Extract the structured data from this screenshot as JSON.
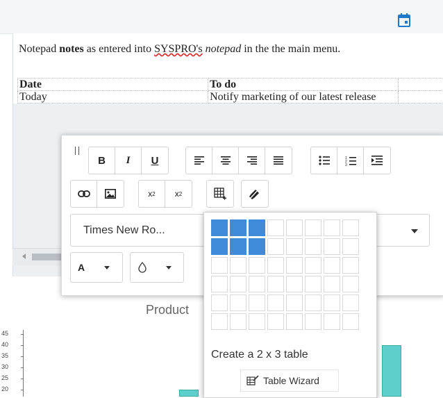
{
  "icons": {
    "calendar": "calendar-icon",
    "grip": "drag-handle-icon",
    "link": "link-icon",
    "image": "image-icon",
    "table_insert": "table-insert-icon",
    "clear_format": "clear-format-icon",
    "text_color": "text-color-icon",
    "fill_color": "fill-color-icon",
    "table_wizard": "table-wizard-icon",
    "align_left": "align-left-icon",
    "align_center": "align-center-icon",
    "align_right": "align-right-icon",
    "align_justify": "align-justify-icon",
    "bullet_list": "bullet-list-icon",
    "numbered_list": "numbered-list-icon",
    "indent": "indent-icon"
  },
  "colors": {
    "accent": "#1f78c8",
    "selected_cell": "#3f8ad9",
    "bar": "#5fcfcb"
  },
  "document": {
    "paragraph": {
      "t1": "Notepad ",
      "t2": "notes",
      "t3": " as entered into ",
      "t4": "SYSPRO's",
      "t5": " ",
      "t6": "notepad",
      "t7": " in the the main menu."
    },
    "table": {
      "headers": [
        "Date",
        "To do",
        ""
      ],
      "rows": [
        [
          "Today",
          "Notify marketing of our latest release",
          ""
        ]
      ]
    }
  },
  "toolbar": {
    "bold": "B",
    "italic": "I",
    "underline": "U",
    "subscript": "x",
    "subscript_mark": "2",
    "superscript": "x",
    "superscript_mark": "2",
    "font_family": "Times New Ro...",
    "text_color_label": "A"
  },
  "table_popup": {
    "rows": 6,
    "cols": 8,
    "selected_rows": 2,
    "selected_cols": 3,
    "label": "Create a 2 x 3 table",
    "wizard_label": "Table Wizard"
  },
  "chart_data": {
    "type": "bar",
    "title": "Product",
    "y_ticks": [
      "45",
      "40",
      "35",
      "30",
      "25",
      "20"
    ],
    "values": [
      20,
      40
    ]
  }
}
